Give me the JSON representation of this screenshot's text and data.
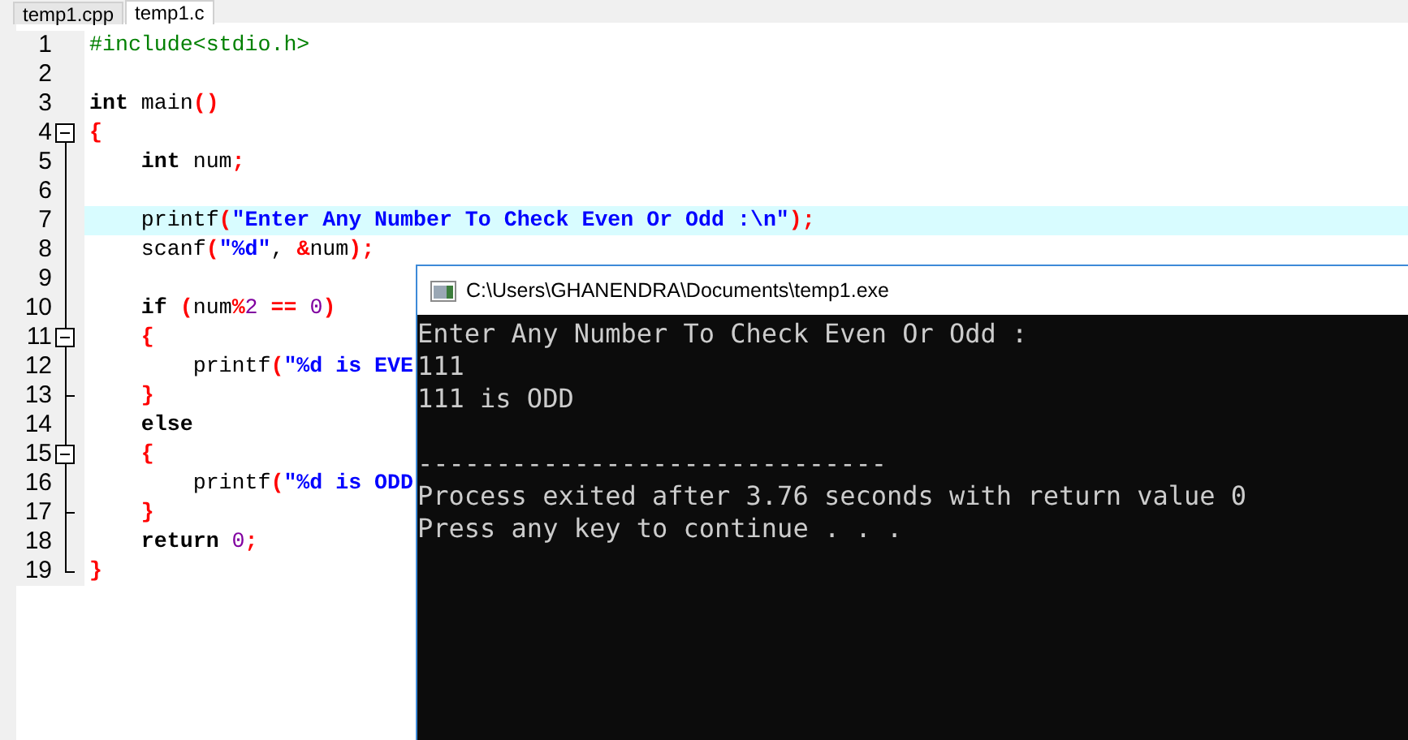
{
  "tabs": [
    {
      "label": "temp1.cpp",
      "selected": false
    },
    {
      "label": "temp1.c",
      "selected": true
    }
  ],
  "editor": {
    "lines": [
      {
        "number": "1",
        "kind": "plain",
        "highlighted": false,
        "tokens": [
          {
            "kind": "preprocessor",
            "text": "#include<stdio.h>"
          }
        ]
      },
      {
        "number": "2",
        "kind": "plain",
        "highlighted": false
      },
      {
        "number": "3",
        "kind": "plain",
        "highlighted": false,
        "tokens": [
          {
            "kind": "keyword",
            "text": "int"
          },
          {
            "kind": "plain",
            "text": " main"
          },
          {
            "kind": "punct",
            "text": "()"
          }
        ]
      },
      {
        "number": "4",
        "kind": "fold-start",
        "highlighted": false,
        "tokens": [
          {
            "kind": "punct",
            "text": "{"
          }
        ]
      },
      {
        "number": "5",
        "kind": "fold-body",
        "highlighted": false,
        "tokens": [
          {
            "kind": "keyword",
            "text": "    int"
          },
          {
            "kind": "plain",
            "text": " num"
          },
          {
            "kind": "punct",
            "text": ";"
          }
        ]
      },
      {
        "number": "6",
        "kind": "fold-body",
        "highlighted": false
      },
      {
        "number": "7",
        "kind": "fold-body",
        "highlighted": true,
        "tokens": [
          {
            "kind": "plain",
            "text": "    printf"
          },
          {
            "kind": "punct",
            "text": "("
          },
          {
            "kind": "string",
            "text": "\"Enter Any Number To Check Even Or Odd :\\n\""
          },
          {
            "kind": "punct",
            "text": ");"
          }
        ]
      },
      {
        "number": "8",
        "kind": "fold-body",
        "highlighted": false,
        "tokens": [
          {
            "kind": "plain",
            "text": "    scanf"
          },
          {
            "kind": "punct",
            "text": "("
          },
          {
            "kind": "string",
            "text": "\"%d\""
          },
          {
            "kind": "plain",
            "text": ", "
          },
          {
            "kind": "punct",
            "text": "&"
          },
          {
            "kind": "plain",
            "text": "num"
          },
          {
            "kind": "punct",
            "text": ");"
          }
        ]
      },
      {
        "number": "9",
        "kind": "fold-body",
        "highlighted": false
      },
      {
        "number": "10",
        "kind": "fold-body",
        "highlighted": false,
        "tokens": [
          {
            "kind": "keyword",
            "text": "    if"
          },
          {
            "kind": "punct",
            "text": " ("
          },
          {
            "kind": "plain",
            "text": "num"
          },
          {
            "kind": "punct",
            "text": "%"
          },
          {
            "kind": "number",
            "text": "2"
          },
          {
            "kind": "punct",
            "text": " =="
          },
          {
            "kind": "number",
            "text": " 0"
          },
          {
            "kind": "punct",
            "text": ")"
          }
        ]
      },
      {
        "number": "11",
        "kind": "fold-start",
        "highlighted": false,
        "tokens": [
          {
            "kind": "punct",
            "text": "    {"
          }
        ]
      },
      {
        "number": "12",
        "kind": "fold-body",
        "highlighted": false,
        "tokens": [
          {
            "kind": "plain",
            "text": "        printf"
          },
          {
            "kind": "punct",
            "text": "("
          },
          {
            "kind": "string",
            "text": "\"%d is EVE"
          }
        ]
      },
      {
        "number": "13",
        "kind": "fold-end",
        "highlighted": false,
        "tokens": [
          {
            "kind": "punct",
            "text": "    }"
          }
        ]
      },
      {
        "number": "14",
        "kind": "fold-body",
        "highlighted": false,
        "tokens": [
          {
            "kind": "keyword",
            "text": "    else"
          }
        ]
      },
      {
        "number": "15",
        "kind": "fold-start",
        "highlighted": false,
        "tokens": [
          {
            "kind": "punct",
            "text": "    {"
          }
        ]
      },
      {
        "number": "16",
        "kind": "fold-body",
        "highlighted": false,
        "tokens": [
          {
            "kind": "plain",
            "text": "        printf"
          },
          {
            "kind": "punct",
            "text": "("
          },
          {
            "kind": "string",
            "text": "\"%d is ODD"
          }
        ]
      },
      {
        "number": "17",
        "kind": "fold-end",
        "highlighted": false,
        "tokens": [
          {
            "kind": "punct",
            "text": "    }"
          }
        ]
      },
      {
        "number": "18",
        "kind": "fold-body",
        "highlighted": false,
        "tokens": [
          {
            "kind": "keyword",
            "text": "    return"
          },
          {
            "kind": "number",
            "text": " 0"
          },
          {
            "kind": "punct",
            "text": ";"
          }
        ]
      },
      {
        "number": "19",
        "kind": "fold-last",
        "highlighted": false,
        "tokens": [
          {
            "kind": "punct",
            "text": "}"
          }
        ]
      }
    ]
  },
  "console": {
    "title": "C:\\Users\\GHANENDRA\\Documents\\temp1.exe",
    "lines": [
      {
        "text": "Enter Any Number To Check Even Or Odd :",
        "blank_before": false
      },
      {
        "text": "111",
        "blank_before": false
      },
      {
        "text": "111 is ODD",
        "blank_before": false
      },
      {
        "text": "------------------------------",
        "blank_before": true
      },
      {
        "text": "Process exited after 3.76 seconds with return value 0",
        "blank_before": false
      },
      {
        "text": "Press any key to continue . . .",
        "blank_before": false
      }
    ]
  }
}
